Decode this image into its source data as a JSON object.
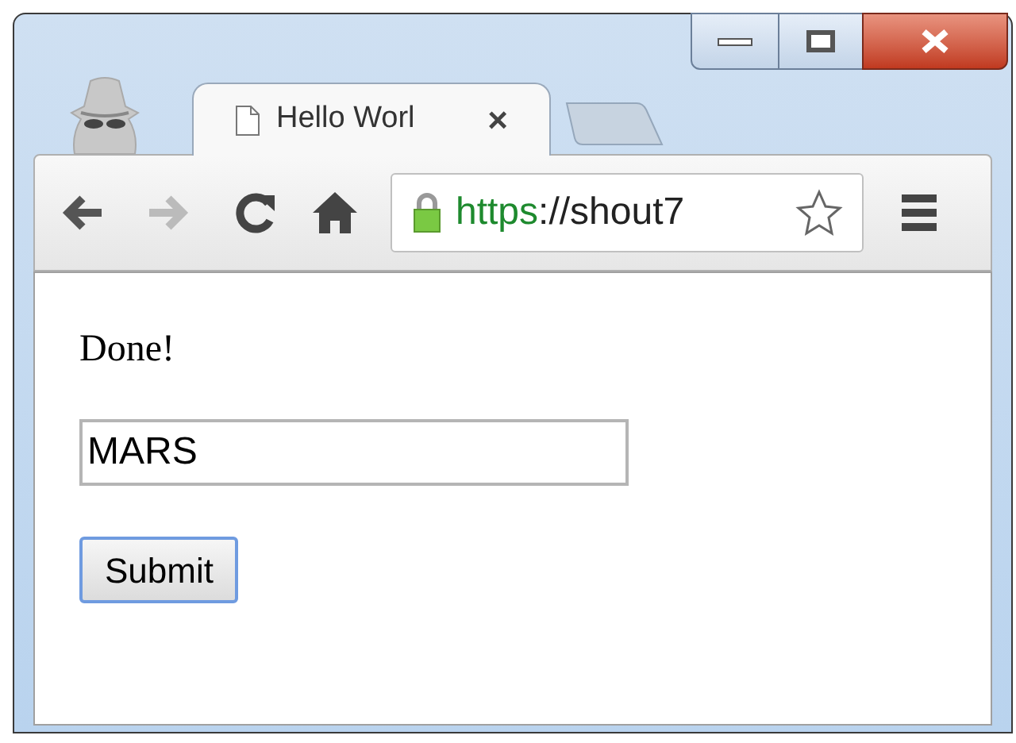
{
  "window": {
    "incognito": true
  },
  "tabs": [
    {
      "title": "Hello Worl",
      "selected": true,
      "close": "×"
    }
  ],
  "toolbar": {
    "forward_disabled": true,
    "url": {
      "secure": true,
      "scheme": "https",
      "rest": "://shout7"
    },
    "bookmarked": false
  },
  "content": {
    "message": "Done!",
    "field": {
      "value": "MARS"
    },
    "button": {
      "label": "Submit",
      "focused": true
    }
  }
}
